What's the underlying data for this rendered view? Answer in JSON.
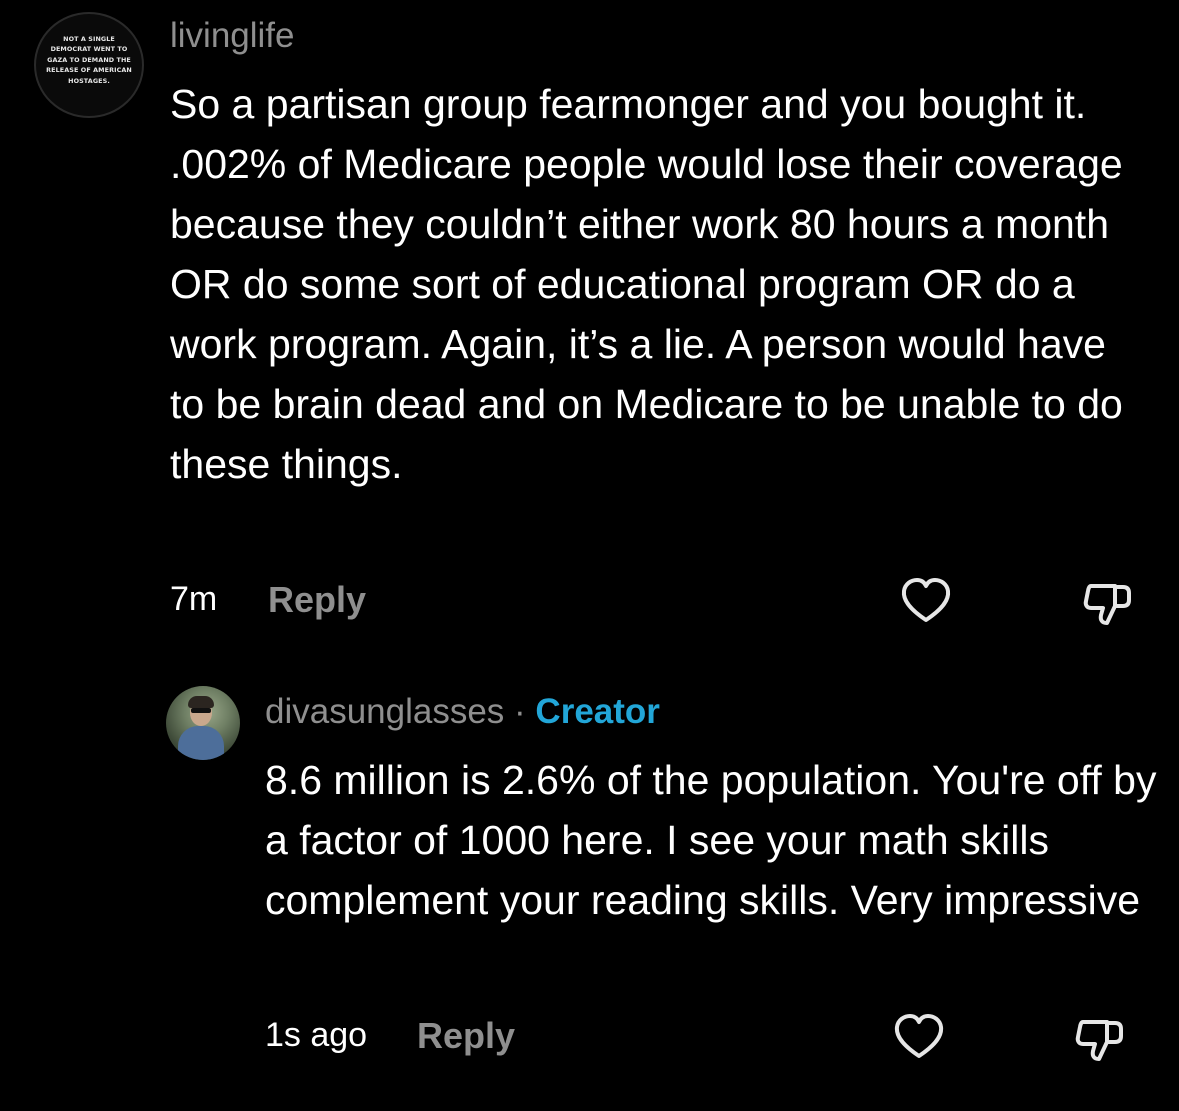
{
  "comments": [
    {
      "avatar_text": "NOT A SINGLE DEMOCRAT WENT TO GAZA TO DEMAND THE RELEASE OF AMERICAN HOSTAGES.",
      "username": "livinglife",
      "body": "So a partisan group fearmonger and you bought it. .002% of Medicare people would lose their coverage because they couldn’t either work 80 hours a month OR do some sort of educational program OR do a work program. Again, it’s a lie. A person would have to be brain dead and on Medicare to be unable to do these things.",
      "time": "7m",
      "reply_label": "Reply",
      "like_icon": "heart-outline-icon",
      "dislike_icon": "thumbs-down-outline-icon"
    },
    {
      "username": "divasunglasses",
      "separator": " · ",
      "badge": "Creator",
      "body": "8.6 million is 2.6% of the population. You're off by a factor of 1000 here. I see your math skills complement your reading skills. Very impressive",
      "time": "1s ago",
      "reply_label": "Reply",
      "like_icon": "heart-outline-icon",
      "dislike_icon": "thumbs-down-outline-icon"
    }
  ],
  "colors": {
    "background": "#000000",
    "primary_text": "#ffffff",
    "secondary_text": "#8f8f8f",
    "creator_badge": "#22a6d8"
  }
}
